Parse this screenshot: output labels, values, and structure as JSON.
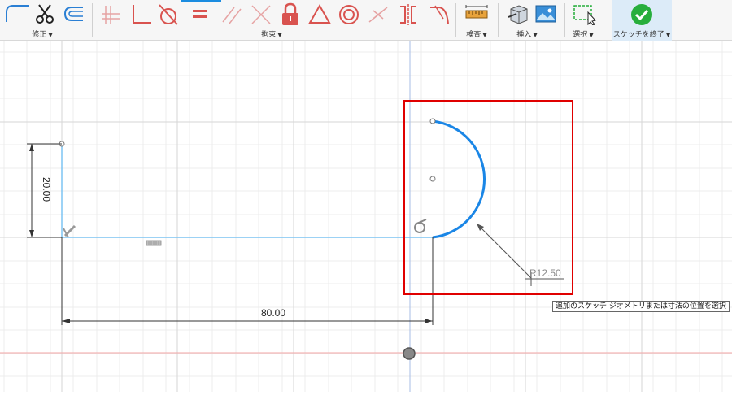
{
  "toolbar": {
    "groups": {
      "modify": {
        "label": "修正"
      },
      "constraints": {
        "label": "拘束"
      },
      "inspect": {
        "label": "検査"
      },
      "insert": {
        "label": "挿入"
      },
      "select": {
        "label": "選択"
      },
      "finish_sketch": {
        "label": "スケッチを終了"
      }
    },
    "caret": "▼",
    "icons": [
      "fillet-icon",
      "trim-icon",
      "offset-icon",
      "horizontal-vertical-icon",
      "perpendicular-icon",
      "tangent-icon",
      "equal-icon",
      "parallel-icon",
      "coincident-icon",
      "fix-lock-icon",
      "triangle-icon",
      "concentric-icon",
      "midpoint-icon",
      "symmetry-icon",
      "curvature-icon",
      "measure-icon",
      "insert-derive-icon",
      "insert-image-icon",
      "select-icon",
      "finish-check-icon"
    ],
    "colors": {
      "constraint_red": "#d9534f",
      "finish_green": "#27ae3c",
      "active_blue": "#1b8ce0"
    }
  },
  "sketch": {
    "dimensions": {
      "vertical": "20.00",
      "horizontal": "80.00",
      "radius": "R12.50"
    },
    "colors": {
      "line": "#7cc4f2",
      "arc": "#1a86e6",
      "selection_box": "#e00000",
      "axis_red": "#f3a6a6",
      "axis_blue": "#a7bde6"
    }
  },
  "status": {
    "tooltip": "追加のスケッチ ジオメトリまたは寸法の位置を選択"
  }
}
